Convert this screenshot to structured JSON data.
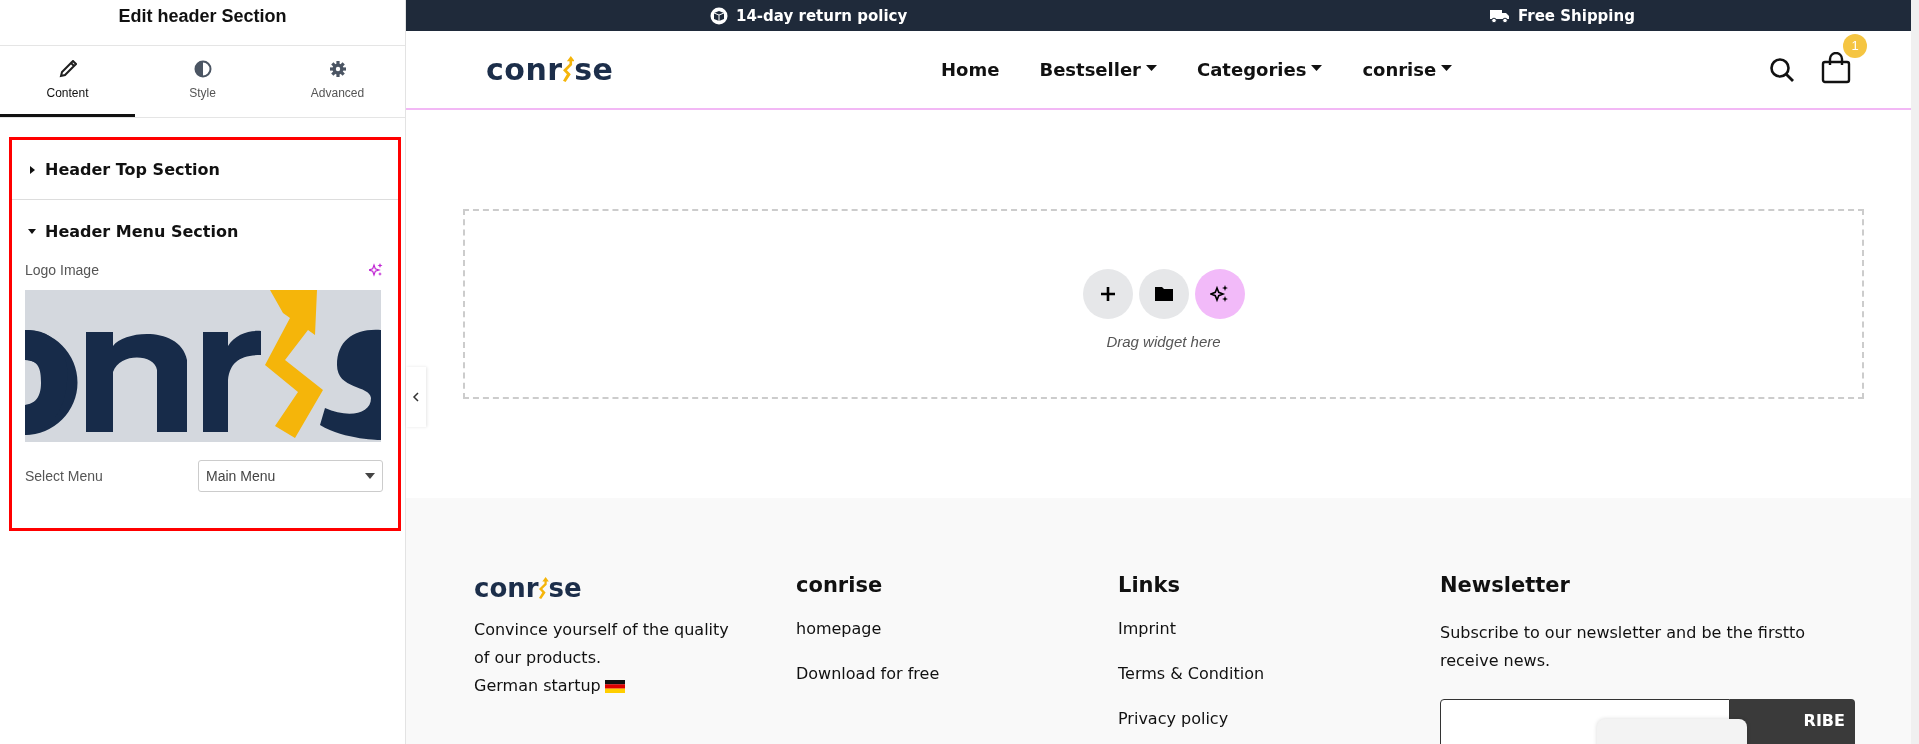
{
  "panel": {
    "title": "Edit header Section",
    "tabs": [
      {
        "label": "Content",
        "selected": true
      },
      {
        "label": "Style",
        "selected": false
      },
      {
        "label": "Advanced",
        "selected": false
      }
    ],
    "sections": [
      {
        "title": "Header Top Section",
        "expanded": false
      },
      {
        "title": "Header Menu Section",
        "expanded": true
      }
    ],
    "logo_image": {
      "label": "Logo Image",
      "kind": "picture"
    },
    "select_menu": {
      "label": "Select Menu",
      "value": "Main Menu"
    }
  },
  "topbar": [
    {
      "text": "14-day return policy"
    },
    {
      "text": "Free Shipping"
    }
  ],
  "header": {
    "logo": {
      "before": "conr",
      "after": "se"
    },
    "nav": [
      {
        "label": "Home",
        "dropdown": false
      },
      {
        "label": "Bestseller",
        "dropdown": true
      },
      {
        "label": "Categories",
        "dropdown": true
      },
      {
        "label": "conrise",
        "dropdown": true
      }
    ],
    "cart_count": "1"
  },
  "dropzone": {
    "hint": "Drag widget here"
  },
  "footer": {
    "logo": {
      "before": "conr",
      "after": "se"
    },
    "about": [
      "Convince yourself of the quality of our products.",
      "German startup"
    ],
    "columns": [
      {
        "heading": "conrise",
        "links": [
          "homepage",
          "Download for free"
        ]
      },
      {
        "heading": "Links",
        "links": [
          "Imprint",
          "Terms & Condition",
          "Privacy policy"
        ]
      }
    ],
    "newsletter": {
      "heading": "Newsletter",
      "text": "Subscribe to our newsletter and be the firstto receive news.",
      "button": "RIBE"
    }
  }
}
